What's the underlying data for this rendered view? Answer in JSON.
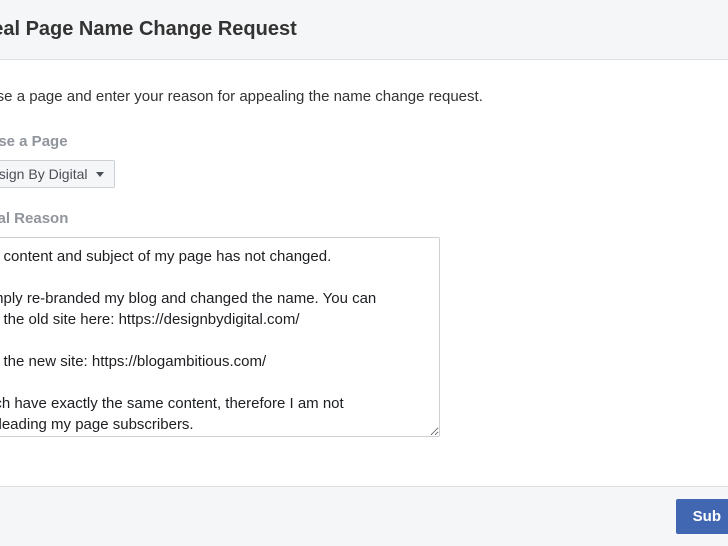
{
  "header": {
    "title": "peal Page Name Change Request"
  },
  "instructions": "oose a page and enter your reason for appealing the name change request.",
  "choosePage": {
    "label": "oose a Page",
    "selected": "esign By Digital"
  },
  "appealReason": {
    "label": "peal Reason",
    "value": "e content and subject of my page has not changed.\n\nmply re-branded my blog and changed the name. You can\ne the old site here: https://designbydigital.com/\n\nd the new site: https://blogambitious.com/\n\nich have exactly the same content, therefore I am not\nsleading my page subscribers."
  },
  "footer": {
    "submitLabel": "Sub"
  }
}
